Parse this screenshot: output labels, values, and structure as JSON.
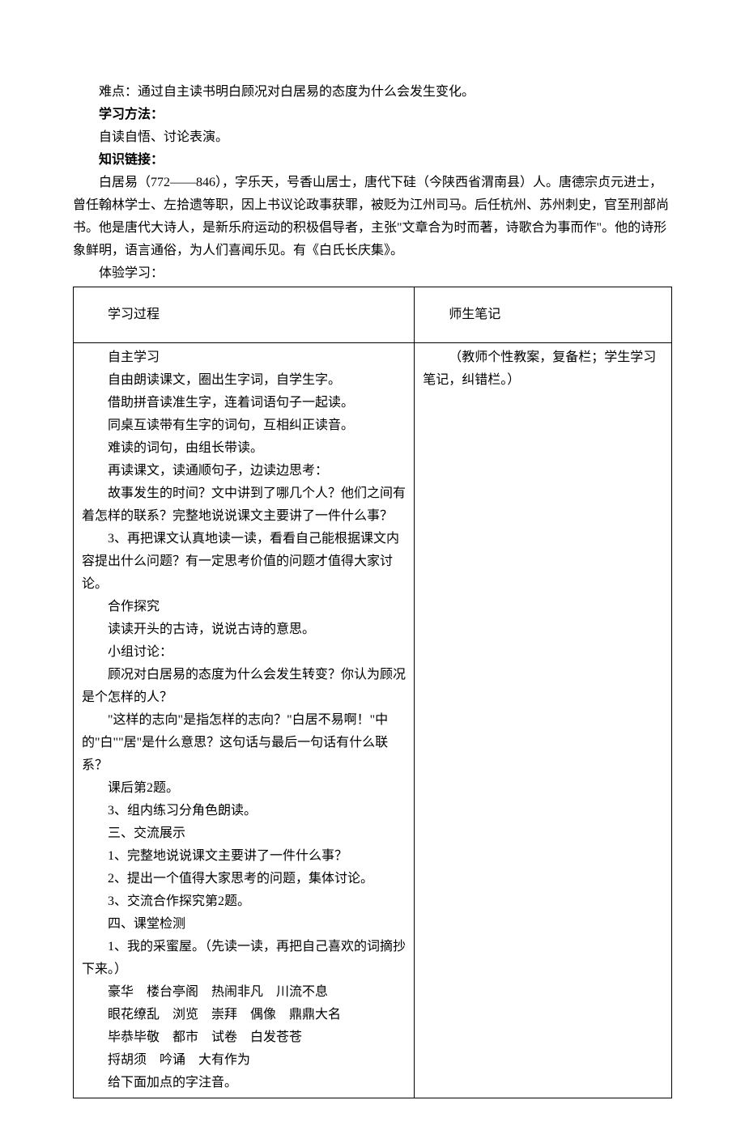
{
  "intro": {
    "nandian_label": "难点：",
    "nandian_text": "通过自主读书明白顾况对白居易的态度为什么会发生变化。",
    "method_label": "学习方法：",
    "method_text": "自读自悟、讨论表演。",
    "link_label": "知识链接：",
    "link_text_1": "白居易（772——846），字乐天，号香山居士，唐代下硅（今陕西省渭南县）人。唐德宗贞元进士，曾任翰林学士、左拾遗等职，因上书议论政事获罪，被贬为江州司马。后任杭州、苏州刺史，官至刑部尚书。他是唐代大诗人，是新乐府运动的积极倡导者，主张\"文章合为时而著，诗歌合为事而作\"。他的诗形象鲜明，语言通俗，为人们喜闻乐见。有《白氏长庆集》。",
    "tiyan": "体验学习："
  },
  "table": {
    "header_left": "学习过程",
    "header_right": "师生笔记",
    "right_note": "（教师个性教案，复备栏；学生学习笔记，纠错栏。）",
    "left_lines": [
      "自主学习",
      "自由朗读课文，圈出生字词，自学生字。",
      "借助拼音读准生字，连着词语句子一起读。",
      "同桌互读带有生字的词句，互相纠正读音。",
      "难读的词句，由组长带读。",
      "再读课文，读通顺句子，边读边思考：",
      "故事发生的时间？文中讲到了哪几个人？他们之间有着怎样的联系？完整地说说课文主要讲了一件什么事？",
      "3、再把课文认真地读一读，看看自己能根据课文内容提出什么问题？有一定思考价值的问题才值得大家讨论。",
      "合作探究",
      "读读开头的古诗，说说古诗的意思。",
      "小组讨论：",
      "顾况对白居易的态度为什么会发生转变？你认为顾况是个怎样的人？",
      "\"这样的志向\"是指怎样的志向？\"白居不易啊！\"中的\"白\"\"居\"是什么意思？这句话与最后一句话有什么联系？",
      "课后第2题。",
      "3、组内练习分角色朗读。",
      "三、交流展示",
      "1、完整地说说课文主要讲了一件什么事？",
      "2、提出一个值得大家思考的问题，集体讨论。",
      "3、交流合作探究第2题。",
      "四、课堂检测",
      "1、我的采蜜屋。（先读一读，再把自己喜欢的词摘抄下来。）",
      "豪华　楼台亭阁　热闹非凡　川流不息",
      "眼花缭乱　浏览　崇拜　偶像　鼎鼎大名",
      "毕恭毕敬　都市　试卷　白发苍苍",
      "捋胡须　吟诵　大有作为",
      "给下面加点的字注音。"
    ]
  }
}
